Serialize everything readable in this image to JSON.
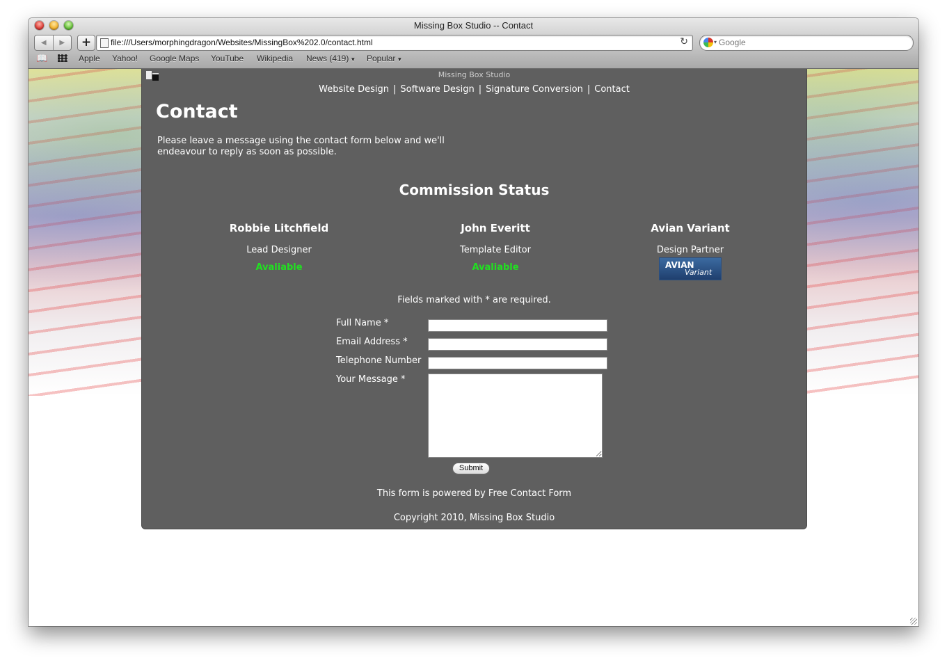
{
  "window": {
    "title": "Missing Box Studio -- Contact",
    "url": "file:///Users/morphingdragon/Websites/MissingBox%202.0/contact.html",
    "search_placeholder": "Google",
    "nav_back": "◀",
    "nav_forward": "▶",
    "add_label": "+",
    "reload_glyph": "↻"
  },
  "bookmarks": [
    {
      "label": "Apple"
    },
    {
      "label": "Yahoo!"
    },
    {
      "label": "Google Maps"
    },
    {
      "label": "YouTube"
    },
    {
      "label": "Wikipedia"
    },
    {
      "label": "News (419)",
      "dropdown": true
    },
    {
      "label": "Popular",
      "dropdown": true
    }
  ],
  "site": {
    "title": "Missing Box Studio",
    "nav": [
      "Website Design",
      "Software Design",
      "Signature Conversion",
      "Contact"
    ],
    "nav_separator": "|"
  },
  "page": {
    "heading": "Contact",
    "intro": "Please leave a message using the contact form below and we'll endeavour to reply as soon as possible."
  },
  "commission": {
    "title": "Commission Status",
    "members": [
      {
        "name": "Robbie Litchfield",
        "role": "Lead Designer",
        "status": "Avaliable"
      },
      {
        "name": "John Everitt",
        "role": "Template Editor",
        "status": "Avaliable"
      },
      {
        "name": "Avian Variant",
        "role": "Design Partner",
        "logo_line1": "AVIAN",
        "logo_line2": "Variant"
      }
    ],
    "status_color": "#21e021"
  },
  "form": {
    "required_note": "Fields marked with * are required.",
    "full_name_label": "Full Name *",
    "email_label": "Email Address *",
    "phone_label": "Telephone Number",
    "message_label": "Your Message *",
    "full_name_value": "",
    "email_value": "",
    "phone_value": "",
    "message_value": "",
    "submit_label": "Submit"
  },
  "footer": {
    "powered_prefix": "This form is powered by ",
    "powered_link": "Free Contact Form",
    "copyright": "Copyright 2010, Missing Box Studio"
  },
  "colors": {
    "panel": "#5f5f5f",
    "available": "#21e021"
  }
}
